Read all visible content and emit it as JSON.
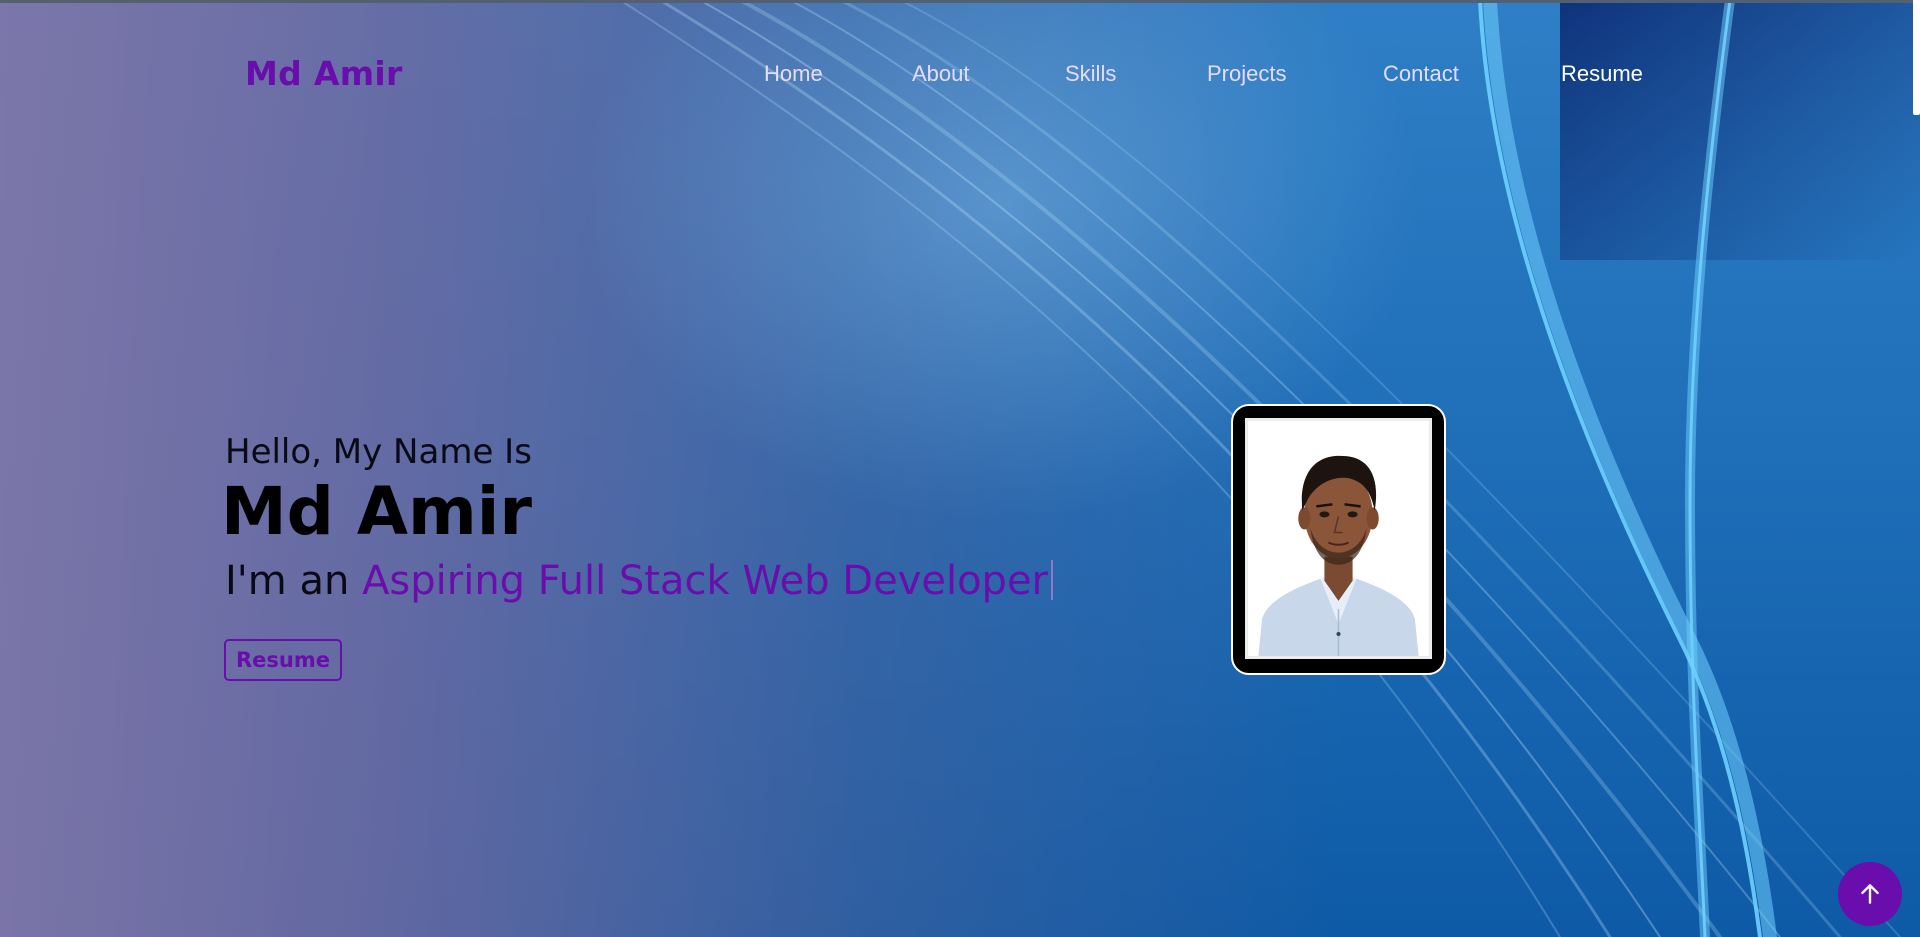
{
  "brand": {
    "name": "Md Amir",
    "color": "#6a0dad"
  },
  "nav": {
    "items": [
      {
        "label": "Home"
      },
      {
        "label": "About"
      },
      {
        "label": "Skills"
      },
      {
        "label": "Projects"
      },
      {
        "label": "Contact"
      },
      {
        "label": "Resume"
      }
    ]
  },
  "hero": {
    "greeting": "Hello, My Name Is",
    "name": "Md Amir",
    "role_prefix": "I'm an ",
    "role_typed": "Aspiring Full Stack Web Developer",
    "resume_button": "Resume"
  },
  "profile_photo": {
    "icon": "person-portrait"
  },
  "scroll_top": {
    "icon": "arrow-up-icon"
  },
  "colors": {
    "accent": "#6a0dad",
    "background_blue": "#1f6fb9",
    "background_purple": "#8076a8",
    "nav_text": "#e6dcff"
  }
}
